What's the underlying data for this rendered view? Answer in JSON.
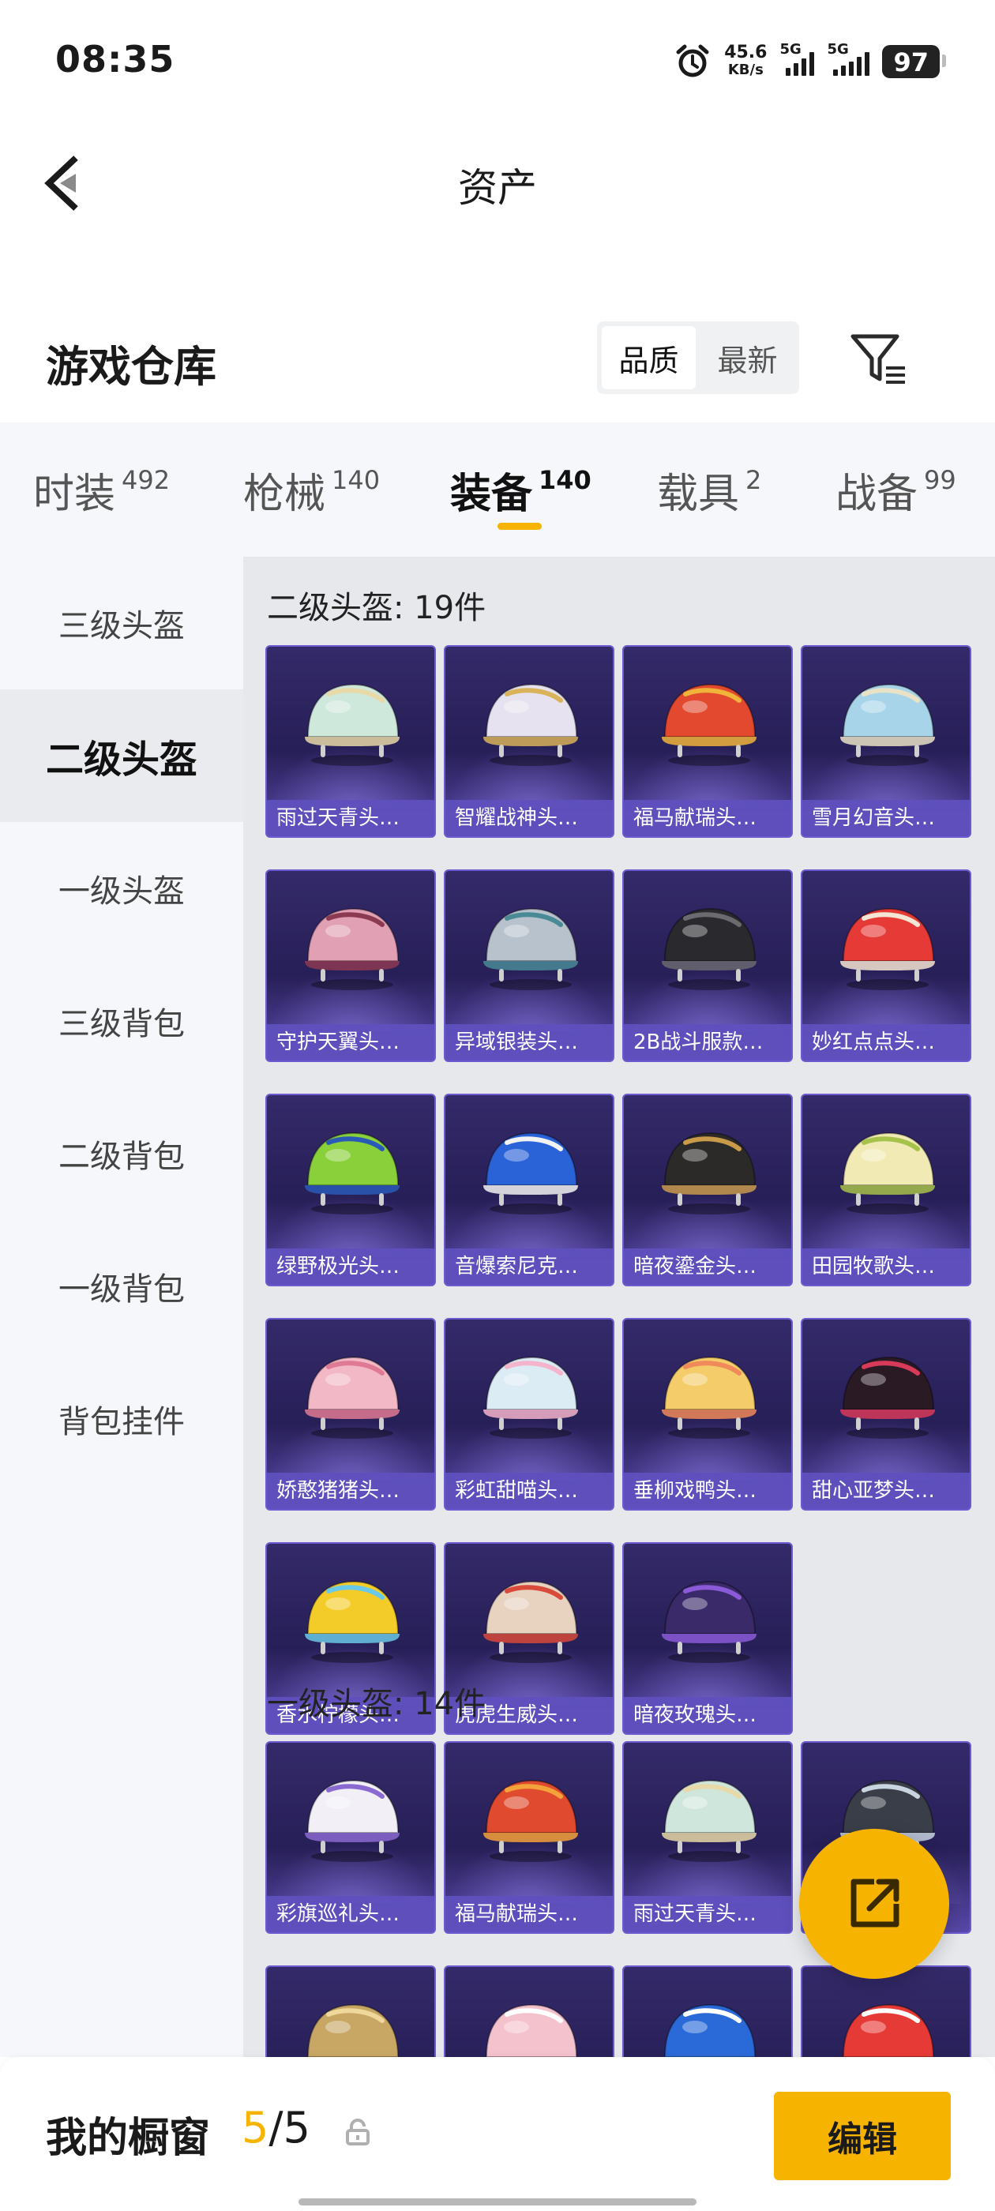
{
  "status_bar": {
    "time": "08:35",
    "speed_value": "45.6",
    "speed_unit": "KB/s",
    "net1": "5G",
    "net2": "5G",
    "battery": "97"
  },
  "header": {
    "title": "资产",
    "back_icon": "chevron-left-icon"
  },
  "warehouse": {
    "title": "游戏仓库",
    "sort_options": [
      "品质",
      "最新"
    ],
    "active_sort": "品质",
    "filter_icon": "filter-icon"
  },
  "categories": [
    {
      "label": "时装",
      "count": "492"
    },
    {
      "label": "枪械",
      "count": "140"
    },
    {
      "label": "装备",
      "count": "140"
    },
    {
      "label": "载具",
      "count": "2"
    },
    {
      "label": "战备",
      "count": "99"
    }
  ],
  "active_category": "装备",
  "sidebar": {
    "items": [
      "三级头盔",
      "二级头盔",
      "一级头盔",
      "三级背包",
      "二级背包",
      "一级背包",
      "背包挂件"
    ],
    "active": "二级头盔"
  },
  "sections": [
    {
      "title": "二级头盔: 19件",
      "items": [
        {
          "name": "雨过天青头…",
          "color": "#cfe8dc",
          "accent": "#e8d9a8"
        },
        {
          "name": "智耀战神头…",
          "color": "#e6e2ef",
          "accent": "#d9b25a"
        },
        {
          "name": "福马献瑞头…",
          "color": "#e2492e",
          "accent": "#f0b43a"
        },
        {
          "name": "雪月幻音头…",
          "color": "#a8d4ea",
          "accent": "#e9e2c6"
        },
        {
          "name": "守护天翼头…",
          "color": "#e2a0b4",
          "accent": "#8c3a52"
        },
        {
          "name": "异域银装头…",
          "color": "#b8c2cc",
          "accent": "#4a8a96"
        },
        {
          "name": "2B战斗服款…",
          "color": "#2a2a2e",
          "accent": "#6a6a70"
        },
        {
          "name": "妙红点点头…",
          "color": "#e63a36",
          "accent": "#f4e6d4"
        },
        {
          "name": "绿野极光头…",
          "color": "#8ad03a",
          "accent": "#2a5ab8"
        },
        {
          "name": "音爆索尼克…",
          "color": "#2a62d8",
          "accent": "#f2f2f2"
        },
        {
          "name": "暗夜鎏金头…",
          "color": "#2c2a28",
          "accent": "#c89a4a"
        },
        {
          "name": "田园牧歌头…",
          "color": "#f2eab4",
          "accent": "#a6c24a"
        },
        {
          "name": "娇憨猪猪头…",
          "color": "#f2b8c6",
          "accent": "#e07a94"
        },
        {
          "name": "彩虹甜喵头…",
          "color": "#dcecf4",
          "accent": "#f4b4cc"
        },
        {
          "name": "垂柳戏鸭头…",
          "color": "#f4cc6a",
          "accent": "#f08a5a"
        },
        {
          "name": "甜心亚梦头…",
          "color": "#2a1a24",
          "accent": "#d83a5a"
        },
        {
          "name": "香水柠檬头…",
          "color": "#f4cc2a",
          "accent": "#6ac8e8"
        },
        {
          "name": "虎虎生威头…",
          "color": "#e8d2c0",
          "accent": "#d84a3a"
        },
        {
          "name": "暗夜玫瑰头…",
          "color": "#3a2a6a",
          "accent": "#8a5ad8"
        }
      ]
    },
    {
      "title": "一级头盔: 14件",
      "items": [
        {
          "name": "彩旗巡礼头…",
          "color": "#f2f0f6",
          "accent": "#8a6ad0"
        },
        {
          "name": "福马献瑞头…",
          "color": "#e04a2e",
          "accent": "#f4a23a"
        },
        {
          "name": "雨过天青头…",
          "color": "#cfe6dc",
          "accent": "#e8d9a8"
        },
        {
          "name": "",
          "color": "#3a3e48",
          "accent": "#c8d4e0"
        },
        {
          "name": "",
          "color": "#c8a664",
          "accent": "#f0d89a"
        },
        {
          "name": "",
          "color": "#f4c2cc",
          "accent": "#ffffff"
        },
        {
          "name": "",
          "color": "#2a6ad8",
          "accent": "#ffffff"
        },
        {
          "name": "",
          "color": "#e63a36",
          "accent": "#ffffff"
        }
      ]
    }
  ],
  "fab": {
    "icon": "share-external-icon"
  },
  "bottom_bar": {
    "label": "我的橱窗",
    "count_current": "5",
    "count_sep": "/",
    "count_total": "5",
    "lock_icon": "lock-icon",
    "edit_label": "编辑"
  },
  "colors": {
    "accent": "#f6b400",
    "card_bg": "#2a2260",
    "card_label_bg": "#5f50be"
  }
}
